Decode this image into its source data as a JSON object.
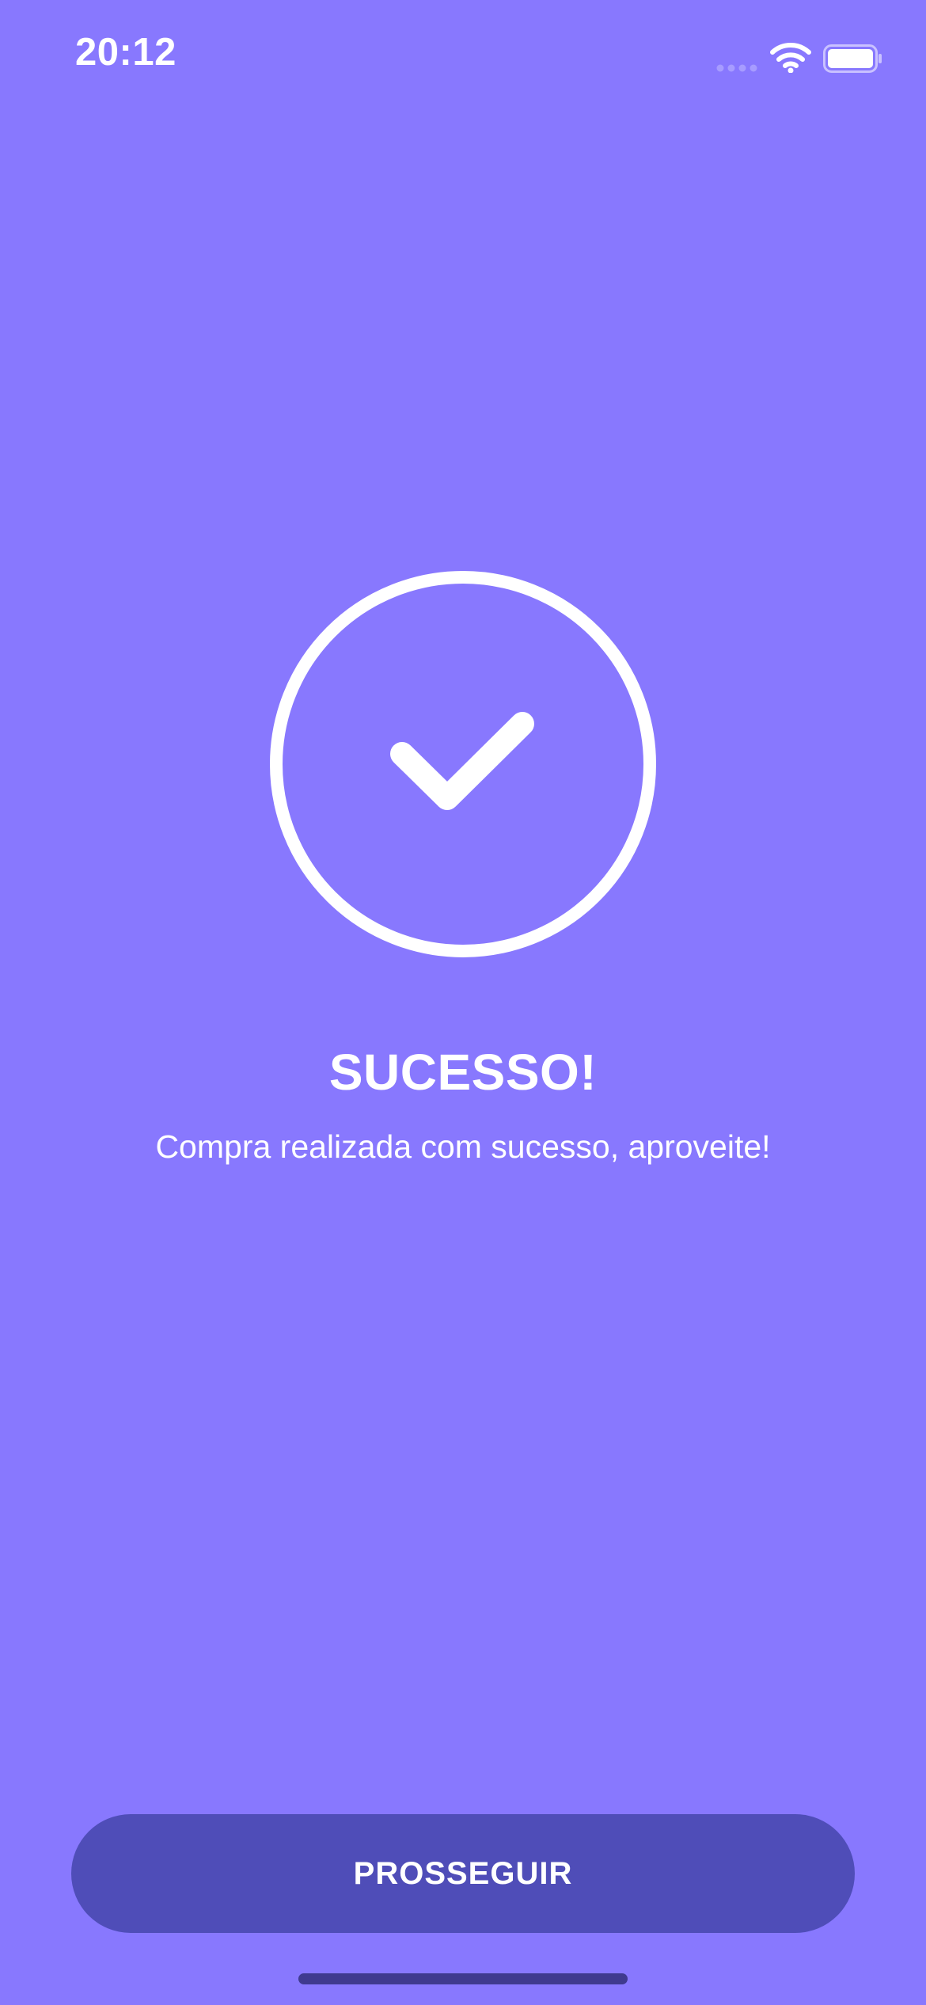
{
  "status_bar": {
    "time": "20:12",
    "icons": [
      "signal-icon",
      "wifi-icon",
      "battery-icon"
    ]
  },
  "success": {
    "icon": "check-circle-icon",
    "title": "SUCESSO!",
    "message": "Compra realizada com sucesso, aproveite!"
  },
  "actions": {
    "proceed_label": "PROSSEGUIR"
  },
  "colors": {
    "background": "#8878FE",
    "button": "#4F4DB8",
    "text": "#FFFFFF"
  }
}
